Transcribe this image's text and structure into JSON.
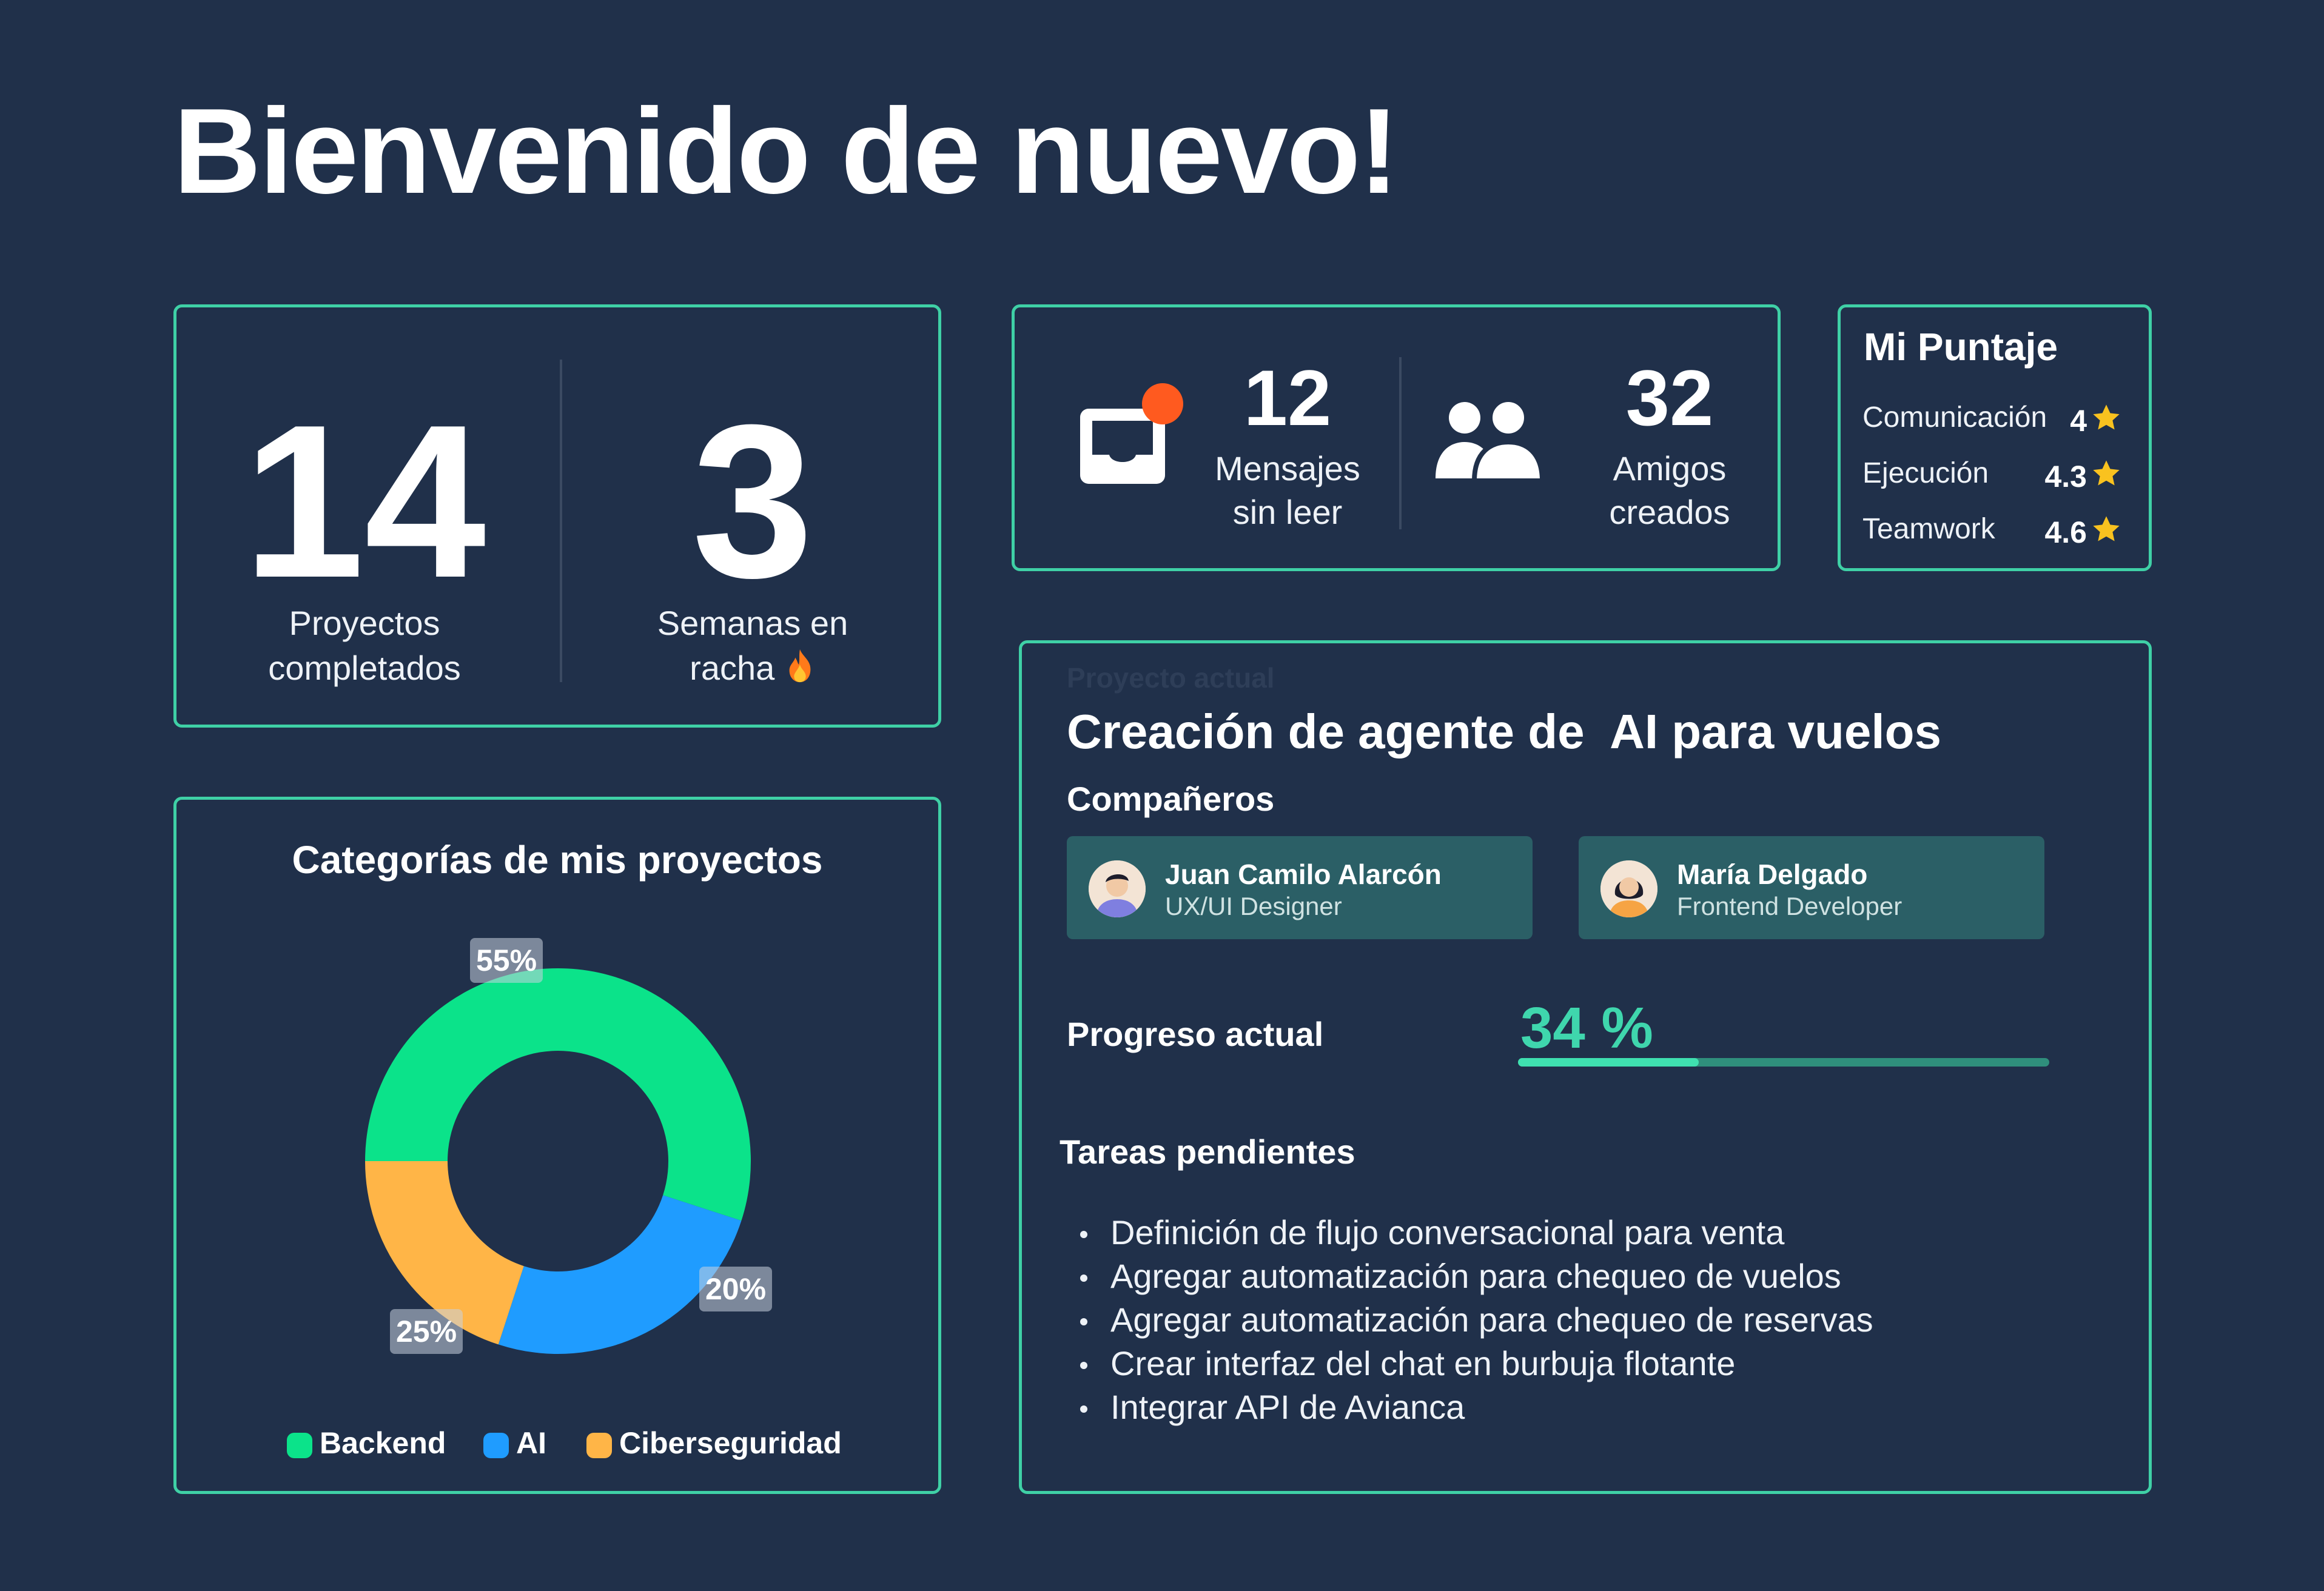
{
  "header": {
    "title": "Bienvenido de nuevo!"
  },
  "stats": {
    "projects_value": "14",
    "projects_label_line1": "Proyectos",
    "projects_label_line2": "completados",
    "weeks_value": "3",
    "weeks_label_line1": "Semanas en",
    "weeks_label_line2": "racha",
    "streak_icon": "fire-icon"
  },
  "social": {
    "messages_value": "12",
    "messages_label_line1": "Mensajes",
    "messages_label_line2": "sin leer",
    "messages_icon": "inbox-icon",
    "friends_value": "32",
    "friends_label_line1": "Amigos",
    "friends_label_line2": "creados",
    "friends_icon": "users-icon",
    "notification_color": "#ff5a1f"
  },
  "score": {
    "title": "Mi Puntaje",
    "items": [
      {
        "name": "Comunicación",
        "value": "4"
      },
      {
        "name": "Ejecución",
        "value": "4.3"
      },
      {
        "name": "Teamwork",
        "value": "4.6"
      }
    ],
    "star_color": "#f9c21f"
  },
  "chart_data": {
    "type": "pie",
    "title": "Categorías de mis proyectos",
    "donut": true,
    "slices": [
      {
        "label": "Backend",
        "value": 55,
        "display": "55%",
        "color": "#0be38a"
      },
      {
        "label": "AI",
        "value": 25,
        "display": "25%",
        "color": "#1f9cff"
      },
      {
        "label": "Ciberseguridad",
        "value": 20,
        "display": "20%",
        "color": "#ffb547"
      }
    ],
    "legend_placement": "bottom"
  },
  "project": {
    "section_label": "Proyecto actual",
    "title": "Creación de agente de  AI para vuelos",
    "teammates_label": "Compañeros",
    "teammates": [
      {
        "name": "Juan Camilo Alarcón",
        "role": "UX/UI Designer"
      },
      {
        "name": "María Delgado",
        "role": "Frontend Developer"
      }
    ],
    "progress_label": "Progreso actual",
    "progress_text": "34 %",
    "progress_value": 0.34,
    "tasks_label": "Tareas pendientes",
    "tasks": [
      "Definición de flujo conversacional para venta",
      "Agregar automatización para chequeo de vuelos",
      "Agregar automatización para chequeo de reservas",
      "Crear interfaz del chat en burbuja flotante",
      "Integrar API de Avianca"
    ]
  },
  "colors": {
    "background": "#20304a",
    "accent_border": "#3fd0a6",
    "progress_text": "#3fd6ad"
  }
}
